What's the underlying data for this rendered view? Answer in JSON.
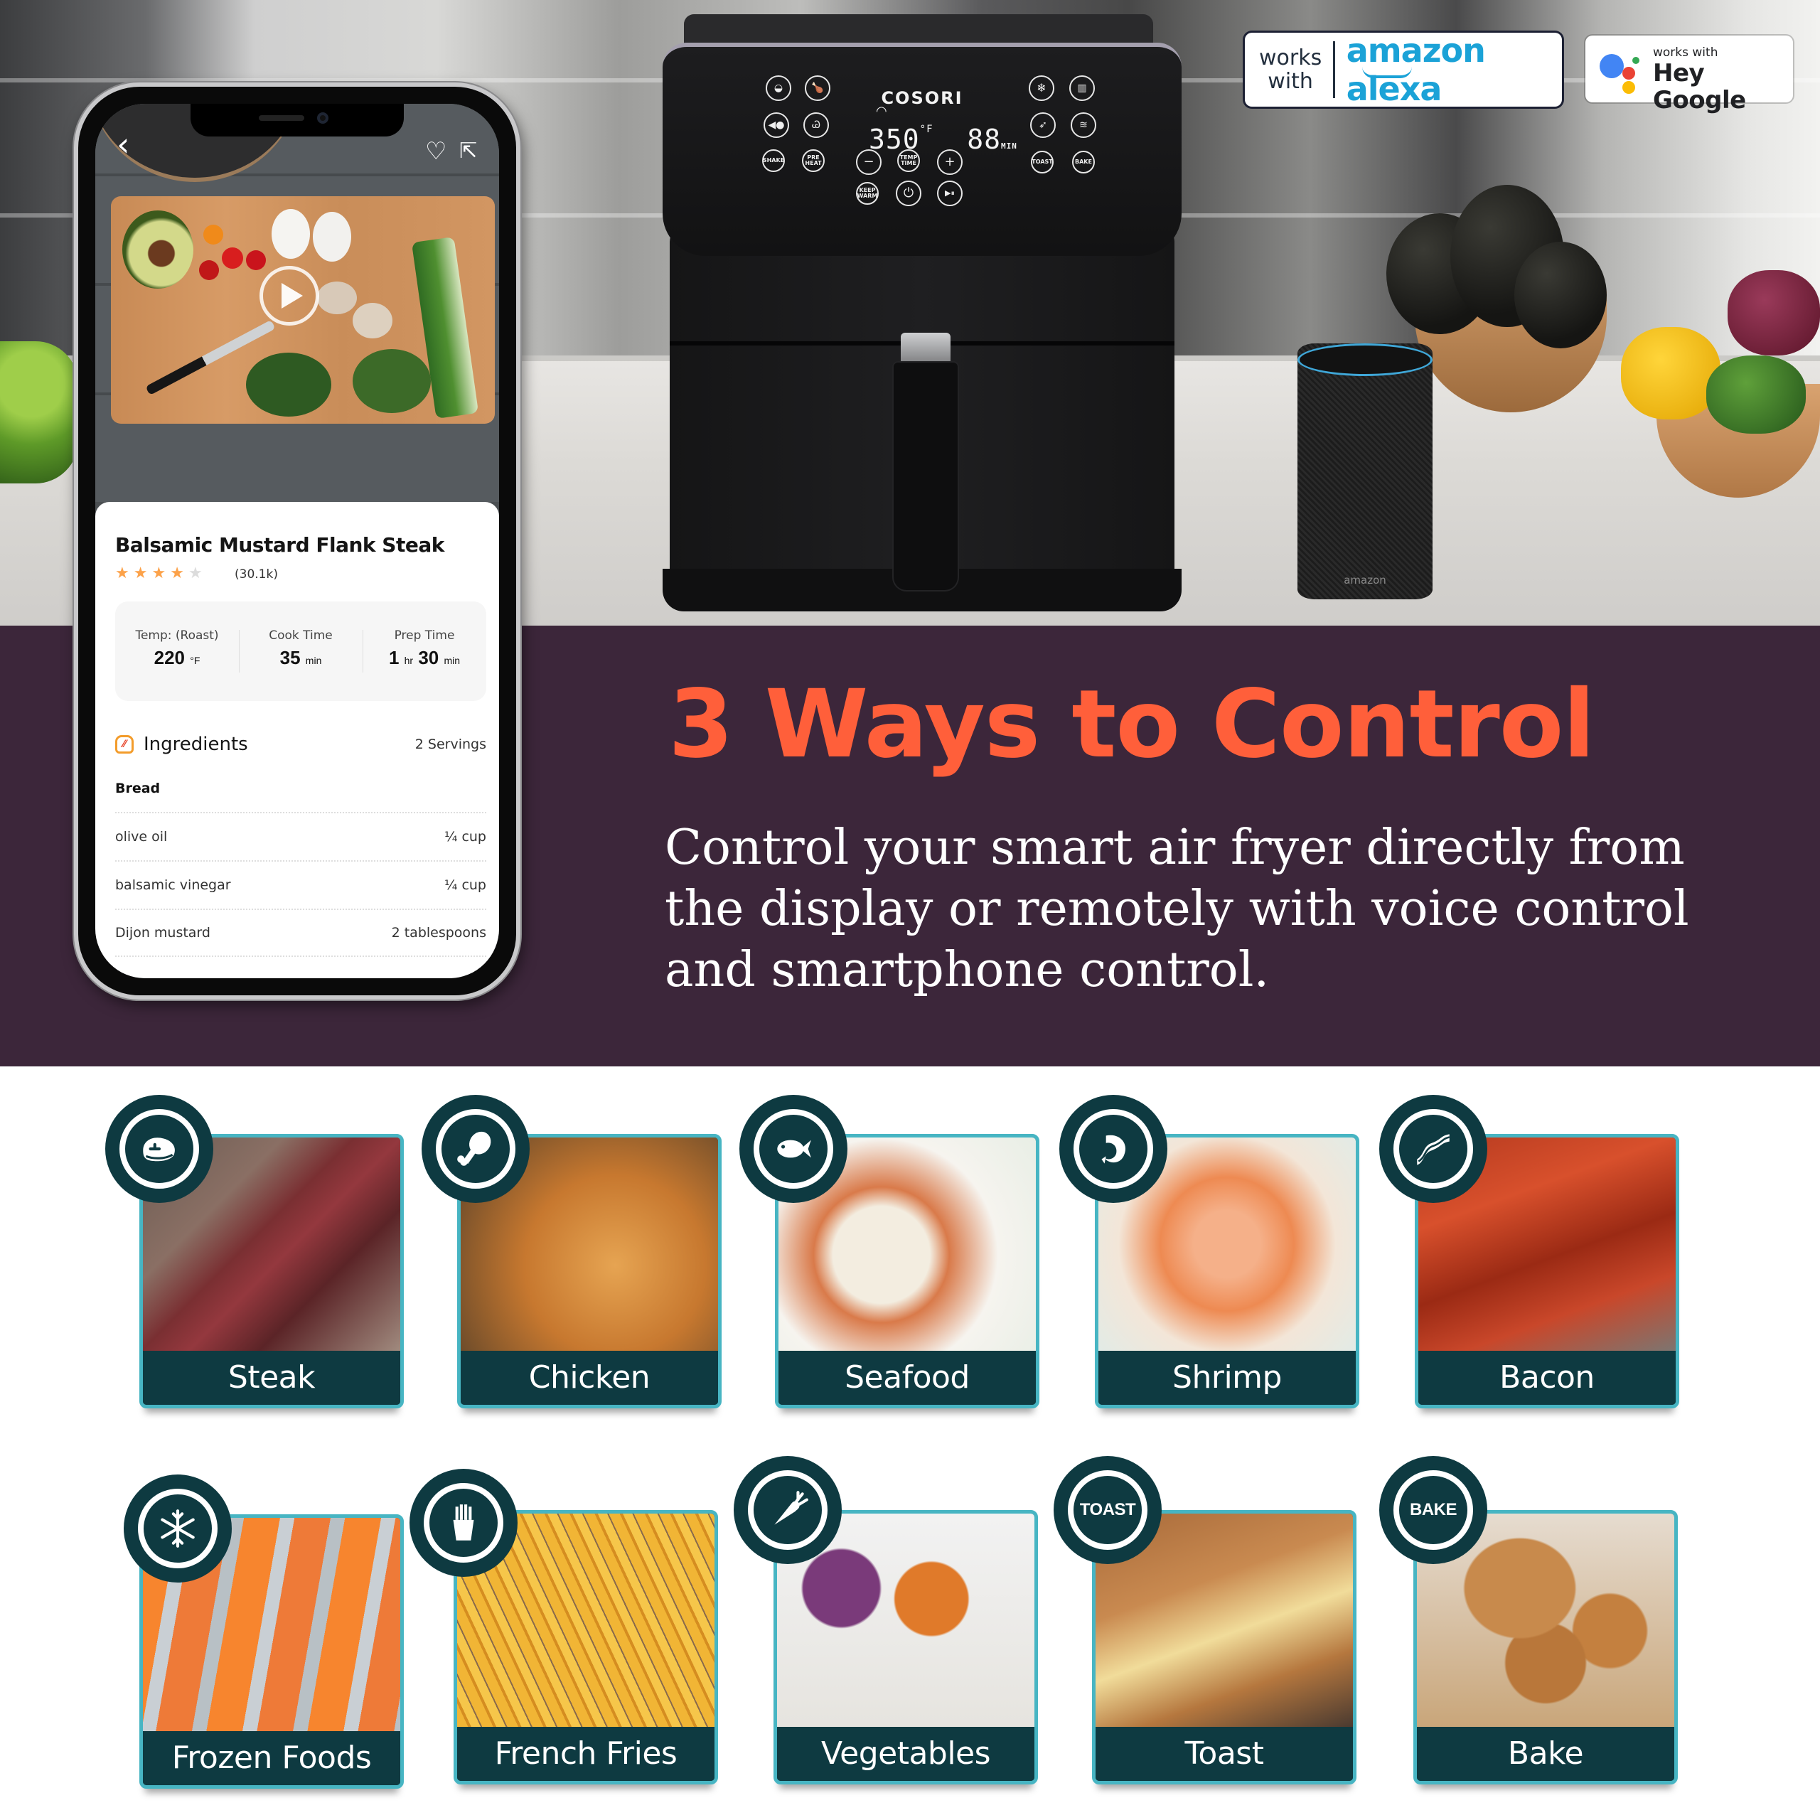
{
  "badges": {
    "alexa": {
      "works_with": "works with",
      "brand": "amazon alexa",
      "color": "#1ba2d7"
    },
    "google": {
      "works_with": "works with",
      "brand": "Hey Google",
      "dot_colors": [
        "#4285f4",
        "#ea4335",
        "#fbbc05",
        "#34a853"
      ]
    }
  },
  "fryer": {
    "brand": "COSORI",
    "display_temp": "350",
    "display_temp_unit": "°F",
    "display_time": "88",
    "display_time_unit": "MIN",
    "buttons": {
      "shake": "SHAKE",
      "preheat": "PRE HEAT",
      "temp_time": "TEMP TIME",
      "keep_warm": "KEEP WARM",
      "toast": "TOAST",
      "bake": "BAKE",
      "minus": "−",
      "plus": "+",
      "power": "⏻",
      "play_pause": "▶⏸"
    }
  },
  "echo": {
    "logo": "amazon"
  },
  "headline": "3 Ways to Control",
  "subtext": "Control your smart air fryer directly from the display or remotely with voice control and smartphone control.",
  "colors": {
    "band": "#3c263a",
    "headline": "#ff5f3a",
    "tile_dark": "#0e3a41",
    "tile_border": "#47b5c3"
  },
  "phone": {
    "nav": {
      "back": "‹",
      "favorite": "♡",
      "share": "⇱"
    },
    "recipe": {
      "title": "Balsamic Mustard Flank Steak",
      "rating": 4,
      "rating_max": 5,
      "rating_count": "(30.1k)",
      "stats": [
        {
          "label": "Temp: (Roast)",
          "value": "220",
          "unit": "°F"
        },
        {
          "label": "Cook Time",
          "value": "35",
          "unit": "min"
        },
        {
          "label": "Prep Time",
          "value": "1",
          "unit": "hr",
          "value2": "30",
          "unit2": "min"
        }
      ],
      "ingredients_title": "Ingredients",
      "servings": "2 Servings",
      "section": "Bread",
      "ingredients": [
        {
          "name": "olive oil",
          "qty": "¼ cup"
        },
        {
          "name": "balsamic vinegar",
          "qty": "¼ cup"
        },
        {
          "name": "Dijon mustard",
          "qty": "2 tablespoons"
        }
      ]
    }
  },
  "presets": [
    {
      "label": "Steak",
      "icon": "steak-icon"
    },
    {
      "label": "Chicken",
      "icon": "chicken-drumstick-icon"
    },
    {
      "label": "Seafood",
      "icon": "fish-icon"
    },
    {
      "label": "Shrimp",
      "icon": "shrimp-icon"
    },
    {
      "label": "Bacon",
      "icon": "bacon-icon"
    },
    {
      "label": "Frozen Foods",
      "icon": "snowflake-icon"
    },
    {
      "label": "French Fries",
      "icon": "fries-icon"
    },
    {
      "label": "Vegetables",
      "icon": "carrot-icon"
    },
    {
      "label": "Toast",
      "icon": "toast-text-icon",
      "icon_text": "TOAST"
    },
    {
      "label": "Bake",
      "icon": "bake-text-icon",
      "icon_text": "BAKE"
    }
  ]
}
